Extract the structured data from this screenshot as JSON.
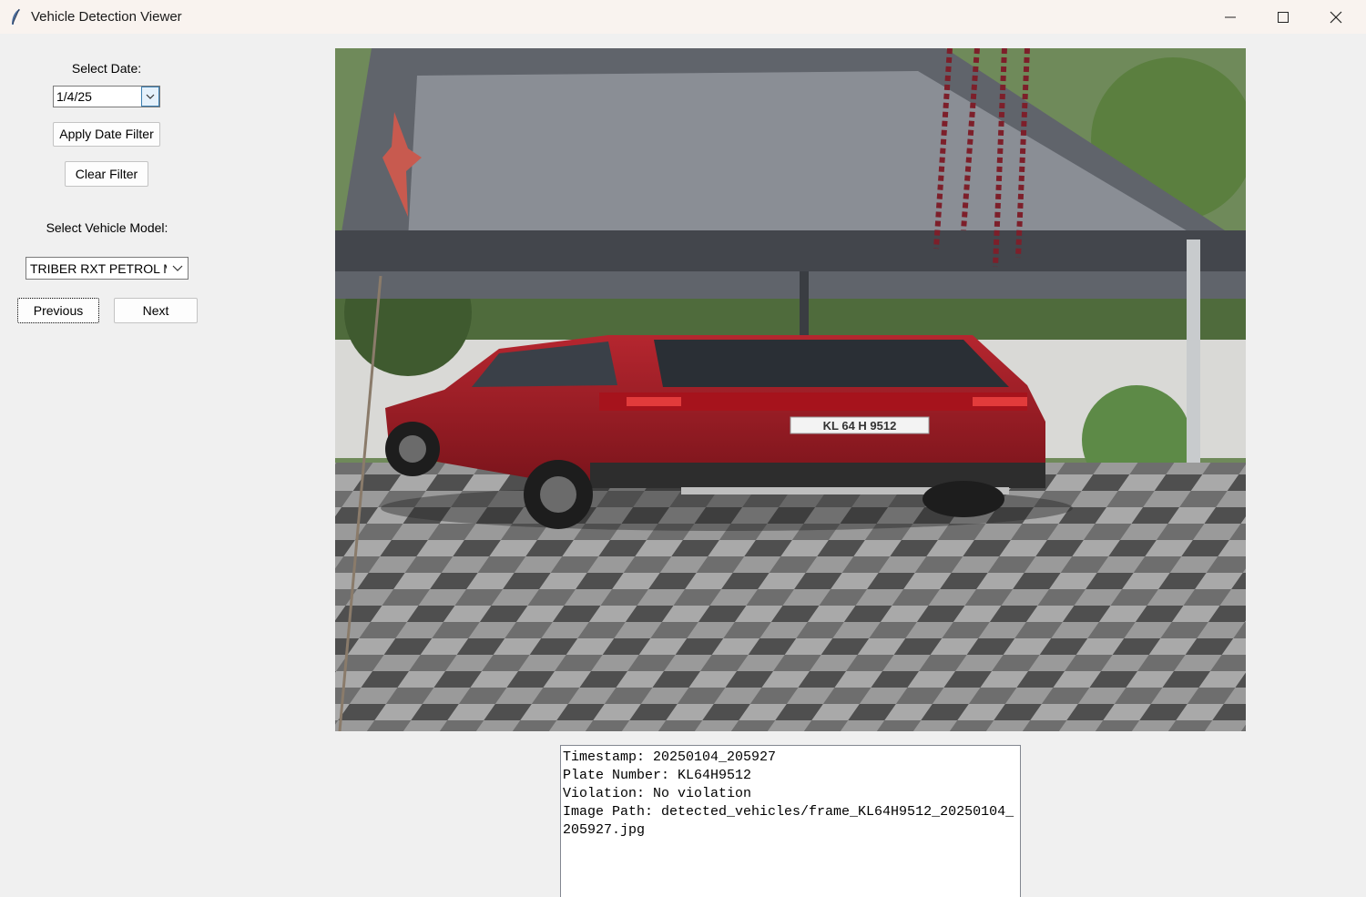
{
  "window": {
    "title": "Vehicle Detection Viewer"
  },
  "filters": {
    "date_label": "Select Date:",
    "date_value": "1/4/25",
    "apply_label": "Apply Date Filter",
    "clear_label": "Clear Filter",
    "model_label": "Select Vehicle Model:",
    "model_value": "TRIBER RXT PETROL MT"
  },
  "nav": {
    "previous_label": "Previous",
    "next_label": "Next"
  },
  "record": {
    "plate_text": "KL 64 H 9512",
    "details": "Timestamp: 20250104_205927\nPlate Number: KL64H9512\nViolation: No violation\nImage Path: detected_vehicles/frame_KL64H9512_20250104_205927.jpg"
  },
  "colors": {
    "car_red": "#9b1c24",
    "accent_blue": "#3c7fb1"
  }
}
